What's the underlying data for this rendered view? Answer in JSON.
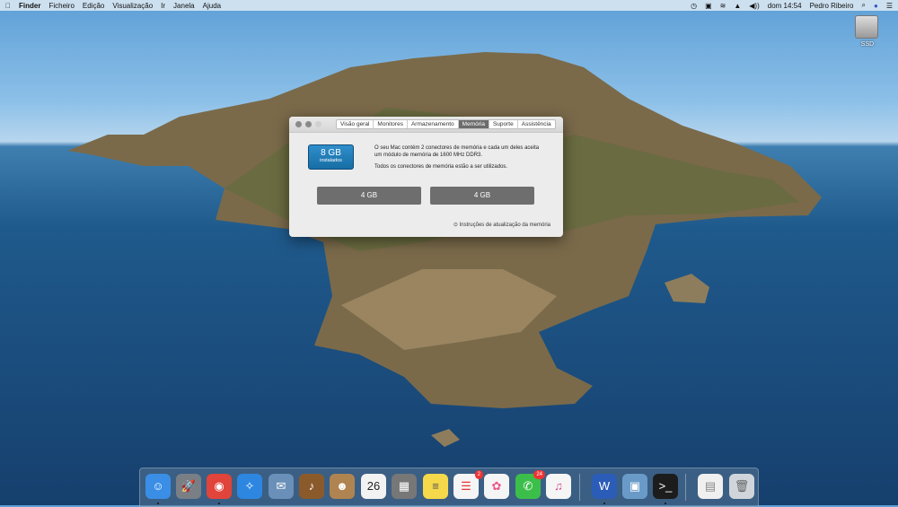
{
  "menubar": {
    "apple": "",
    "app": "Finder",
    "items": [
      "Ficheiro",
      "Edição",
      "Visualização",
      "Ir",
      "Janela",
      "Ajuda"
    ],
    "status": {
      "time_machine": "◷",
      "display": "▣",
      "wifi": "≋",
      "eject": "▲",
      "volume": "◀))",
      "clock": "dom 14:54",
      "user": "Pedro Ribeiro",
      "search": "⌕",
      "siri": "●",
      "notifications": "☰"
    }
  },
  "desktop": {
    "ssd_label": "SSD"
  },
  "window": {
    "tabs": [
      "Visão geral",
      "Monitores",
      "Armazenamento",
      "Memória",
      "Suporte",
      "Assistência"
    ],
    "active_tab": "Memória",
    "memory_total": "8 GB",
    "memory_installed": "instalados",
    "desc1": "O seu Mac contém 2 conectores de memória e cada um deles aceita um módulo de memória de 1600 MHz DDR3.",
    "desc2": "Todos os conectores de memória estão a ser utilizados.",
    "slots": [
      "4 GB",
      "4 GB"
    ],
    "upgrade_link": "Instruções de atualização da memória"
  },
  "dock": {
    "apps": [
      {
        "name": "finder",
        "glyph": "☺",
        "color": "#3a8ee6",
        "running": true
      },
      {
        "name": "launchpad",
        "glyph": "🚀",
        "color": "#7a7f86"
      },
      {
        "name": "chrome",
        "glyph": "◉",
        "color": "#e0443a",
        "running": true
      },
      {
        "name": "safari",
        "glyph": "✧",
        "color": "#2d86e0"
      },
      {
        "name": "mail-preview",
        "glyph": "✉",
        "color": "#6a8fb8"
      },
      {
        "name": "garageband",
        "glyph": "♪",
        "color": "#8b5a2b"
      },
      {
        "name": "contacts",
        "glyph": "☻",
        "color": "#b08450"
      },
      {
        "name": "calendar",
        "glyph": "26",
        "color": "#f2f2f2",
        "text": "#222"
      },
      {
        "name": "calculator",
        "glyph": "▦",
        "color": "#777"
      },
      {
        "name": "notes",
        "glyph": "≡",
        "color": "#f6d94a",
        "text": "#555"
      },
      {
        "name": "reminders",
        "glyph": "☰",
        "color": "#f5f5f5",
        "text": "#e33",
        "badge": "2"
      },
      {
        "name": "photos",
        "glyph": "✿",
        "color": "#f5f5f5",
        "text": "#e58"
      },
      {
        "name": "facetime",
        "glyph": "✆",
        "color": "#3cbf4a",
        "badge": "24"
      },
      {
        "name": "itunes",
        "glyph": "♫",
        "color": "#f5f5f5",
        "text": "#d4488a"
      },
      {
        "name": "word",
        "glyph": "W",
        "color": "#2b5cb8",
        "running": true
      },
      {
        "name": "preview",
        "glyph": "▣",
        "color": "#6a9bc8"
      },
      {
        "name": "terminal",
        "glyph": ">_",
        "color": "#1c1c1c",
        "running": true
      },
      {
        "name": "downloads",
        "glyph": "▤",
        "color": "#f0f0f0",
        "text": "#888"
      },
      {
        "name": "trash",
        "glyph": "🗑",
        "color": "#cfd5da",
        "text": "#666"
      }
    ]
  }
}
